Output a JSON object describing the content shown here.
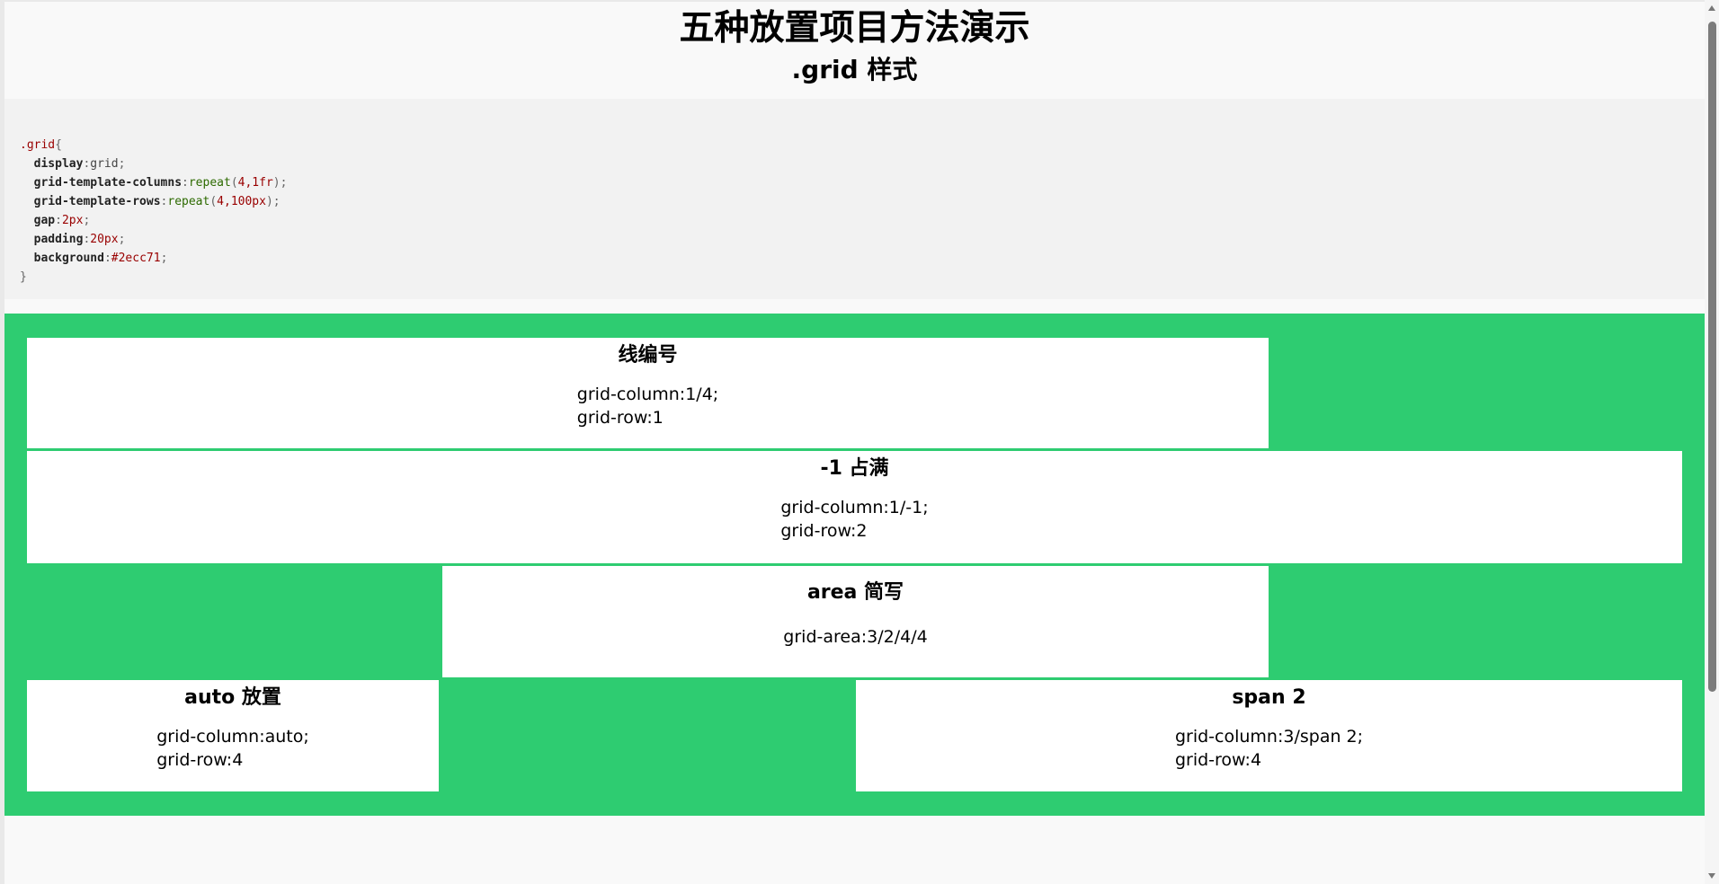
{
  "header": {
    "title": "五种放置项目方法演示",
    "subtitle": ".grid 样式"
  },
  "code": {
    "selector": ".grid",
    "open_brace": "{",
    "close_brace": "}",
    "lines": [
      {
        "prop": "display",
        "value": "grid",
        "value_type": "plain"
      },
      {
        "prop": "grid-template-columns",
        "fn": "repeat",
        "args": "4,1fr"
      },
      {
        "prop": "grid-template-rows",
        "fn": "repeat",
        "args": "4,100px"
      },
      {
        "prop": "gap",
        "value": "2px",
        "value_type": "num"
      },
      {
        "prop": "padding",
        "value": "20px",
        "value_type": "num"
      },
      {
        "prop": "background",
        "value": "#2ecc71",
        "value_type": "num"
      }
    ]
  },
  "colors": {
    "grid_background": "#2ecc71",
    "item_background": "#ffffff",
    "code_background": "#f2f2f2"
  },
  "items": [
    {
      "title": "线编号",
      "code": [
        "grid-column:1/4;",
        "grid-row:1"
      ]
    },
    {
      "title": "-1 占满",
      "code": [
        "grid-column:1/-1;",
        "grid-row:2"
      ]
    },
    {
      "title": "area 简写",
      "code": [
        "grid-area:3/2/4/4"
      ]
    },
    {
      "title": "auto 放置",
      "code": [
        "grid-column:auto;",
        "grid-row:4"
      ]
    },
    {
      "title": "span 2",
      "code": [
        "grid-column:3/span 2;",
        "grid-row:4"
      ]
    }
  ]
}
